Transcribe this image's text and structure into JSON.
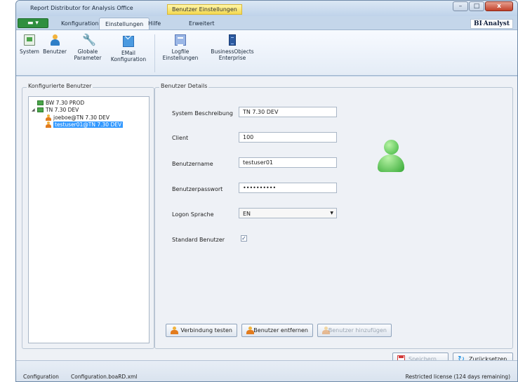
{
  "window": {
    "title": "Report Distributor for Analysis Office",
    "context_tab": "Benutzer Einstellungen",
    "controls": {
      "minimize": "–",
      "maximize": "□",
      "close": "x"
    }
  },
  "ribbon_tabs": {
    "file_icon": "app-menu-icon",
    "tabs": [
      "Konfiguration",
      "Einstellungen",
      "Hilfe",
      "Erweitert"
    ],
    "active": "Einstellungen"
  },
  "logo": {
    "text": "BI",
    "subtext": "Analyst"
  },
  "ribbon_buttons": [
    {
      "label": "System",
      "icon": "system-icon"
    },
    {
      "label": "Benutzer",
      "icon": "user-icon"
    },
    {
      "label": "Globale\nParameter",
      "icon": "wrench-icon"
    },
    {
      "label": "EMail\nKonfiguration",
      "icon": "mail-icon"
    },
    {
      "label": "Logfile\nEinstellungen",
      "icon": "logfile-icon"
    },
    {
      "label": "BusinessObjects\nEnterprise",
      "icon": "server-icon"
    }
  ],
  "left_panel": {
    "title": "Konfigurierte Benutzer",
    "tree": [
      {
        "label": "BW 7.30 PROD",
        "type": "system",
        "expanded": false
      },
      {
        "label": "TN 7.30 DEV",
        "type": "system",
        "expanded": true
      },
      {
        "label": "joeboe@TN 7.30 DEV",
        "type": "user"
      },
      {
        "label": "testuser01@TN 7.30 DEV",
        "type": "user",
        "selected": true
      }
    ]
  },
  "details": {
    "title": "Benutzer Details",
    "system_desc_label": "System Beschreibung",
    "system_desc_value": "TN 7.30 DEV",
    "client_label": "Client",
    "client_value": "100",
    "username_label": "Benutzername",
    "username_value": "testuser01",
    "password_label": "Benutzerpasswort",
    "password_value": "••••••••••",
    "logon_lang_label": "Logon Sprache",
    "logon_lang_value": "EN",
    "default_user_label": "Standard Benutzer",
    "default_user_checked": "✓",
    "avatar_icon": "user-avatar-icon"
  },
  "buttons": {
    "test_connection": "Verbindung testen",
    "remove_user": "Benutzer entfernen",
    "add_user": "Benutzer hinzufügen",
    "save": "Speichern",
    "reset": "Zurücksetzen"
  },
  "statusbar": {
    "left": "Configuration",
    "file": "Configuration.boaRD.xml",
    "right": "Restricted license (124 days remaining)"
  }
}
